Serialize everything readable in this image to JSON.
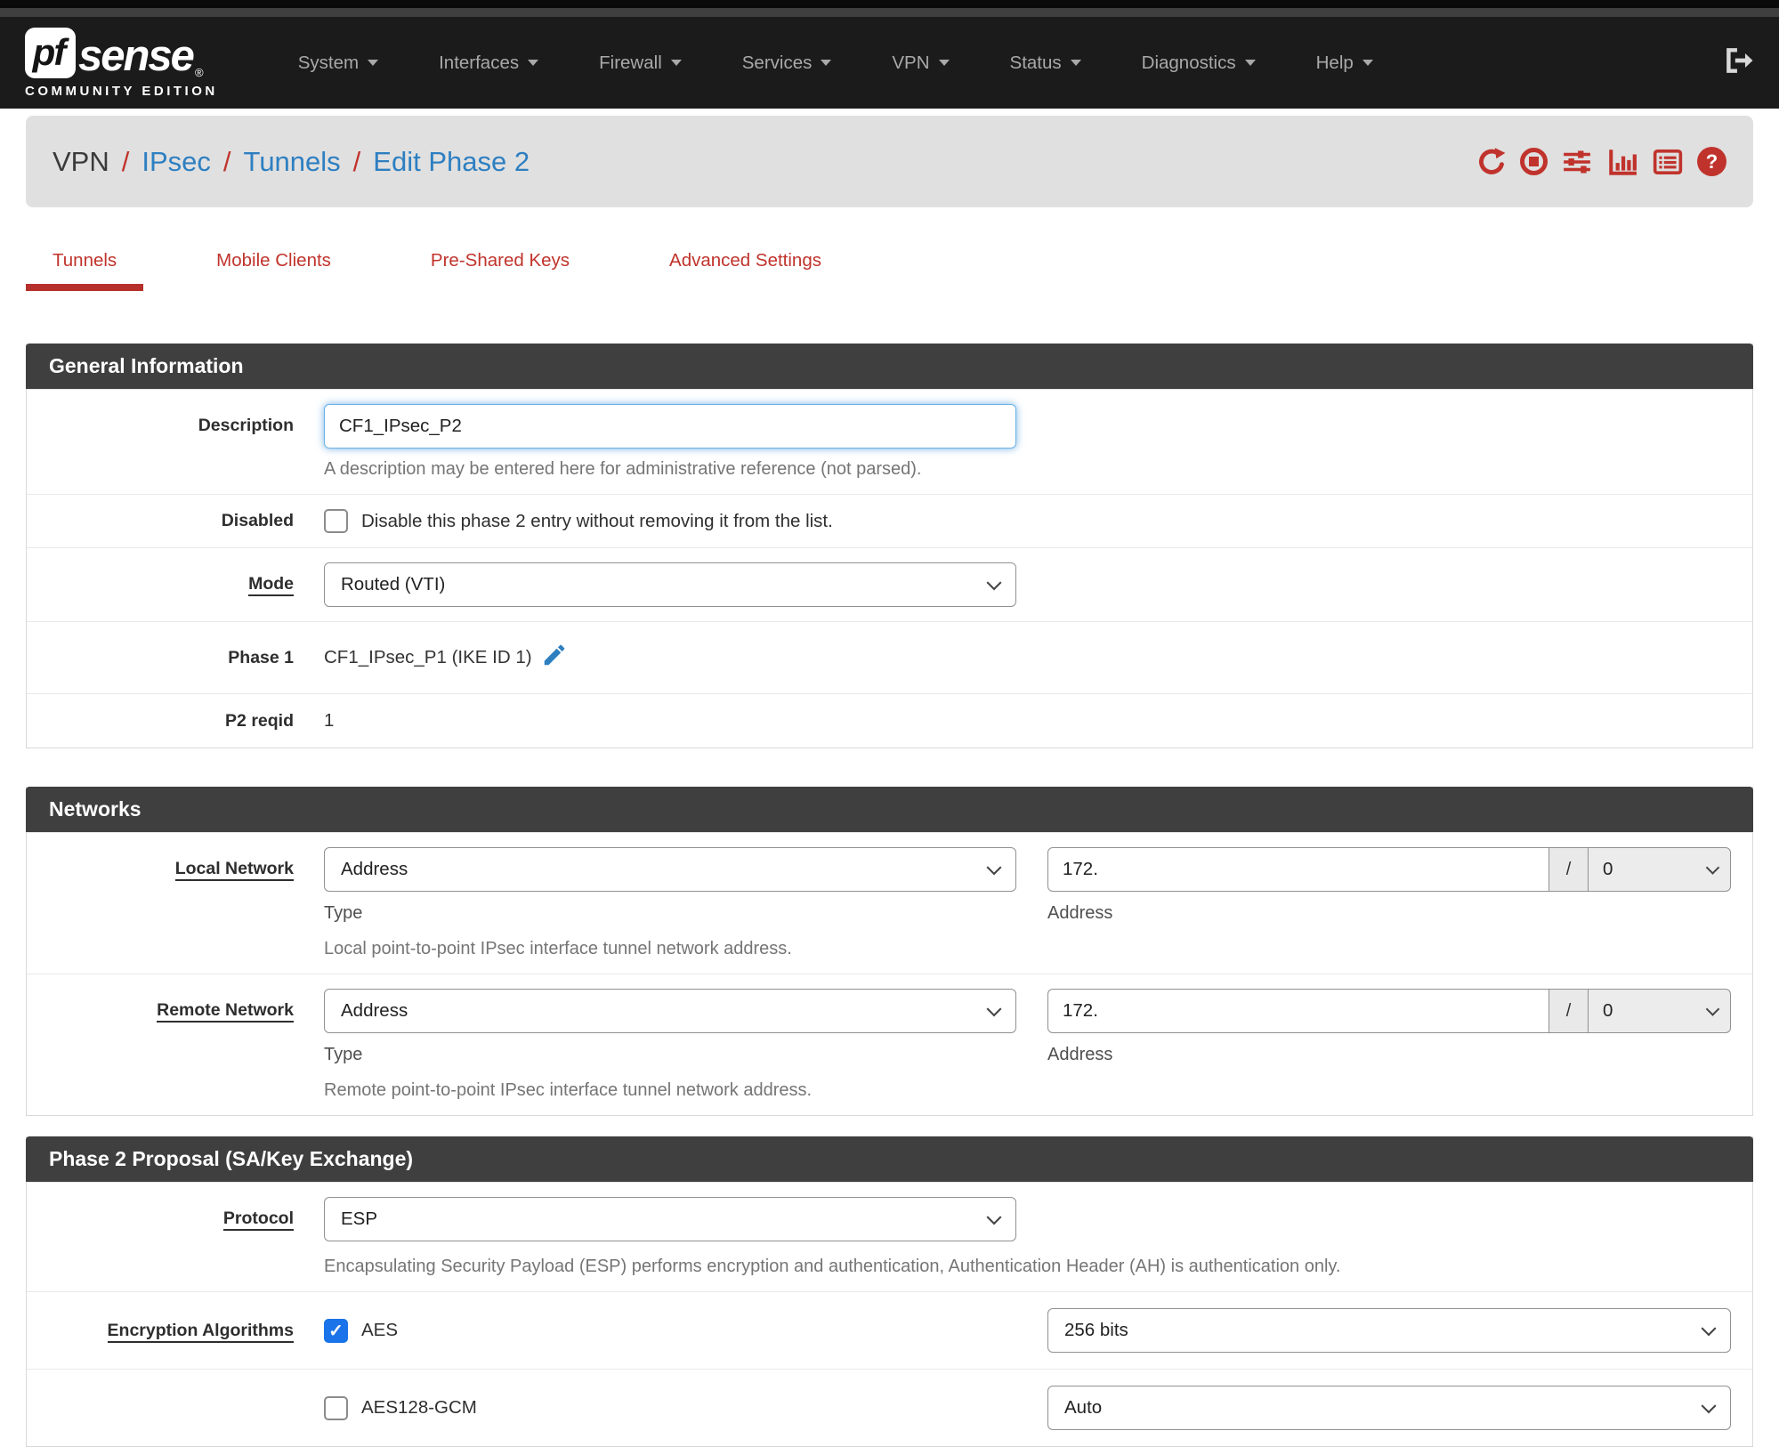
{
  "colors": {
    "accent_red": "#c0332c",
    "link_blue": "#2e7fc1",
    "navbar_bg": "#1b1b1b",
    "panel_heading_bg": "#3f3f3f",
    "breadcrumb_bg": "#e0e0e0",
    "checkbox_checked_blue": "#1a73e8",
    "pencil_blue": "#2e7fc0"
  },
  "navbar": {
    "logo": {
      "pf": "pf",
      "sense": "sense",
      "registered": "®",
      "subtitle": "COMMUNITY EDITION"
    },
    "items": [
      "System",
      "Interfaces",
      "Firewall",
      "Services",
      "VPN",
      "Status",
      "Diagnostics",
      "Help"
    ],
    "logout_icon": "sign-out-icon"
  },
  "breadcrumb": {
    "current": "VPN",
    "sep": "/",
    "links": [
      "IPsec",
      "Tunnels",
      "Edit Phase 2"
    ],
    "icons": [
      "refresh-icon",
      "stop-icon",
      "sliders-icon",
      "chart-bar-icon",
      "log-icon",
      "help-icon"
    ]
  },
  "tabs": {
    "items": [
      "Tunnels",
      "Mobile Clients",
      "Pre-Shared Keys",
      "Advanced Settings"
    ],
    "active": "Tunnels"
  },
  "general": {
    "title": "General Information",
    "description_label": "Description",
    "description_value": "CF1_IPsec_P2",
    "description_help": "A description may be entered here for administrative reference (not parsed).",
    "disabled_label": "Disabled",
    "disabled_text": "Disable this phase 2 entry without removing it from the list.",
    "disabled_checked": false,
    "mode_label": "Mode",
    "mode_value": "Routed (VTI)",
    "phase1_label": "Phase 1",
    "phase1_value": "CF1_IPsec_P1 (IKE ID 1)",
    "p2reqid_label": "P2 reqid",
    "p2reqid_value": "1"
  },
  "networks": {
    "title": "Networks",
    "separator": "/",
    "local": {
      "label": "Local Network",
      "type_value": "Address",
      "type_caption": "Type",
      "address_value": "172.",
      "address_caption": "Address",
      "prefix_value": "0",
      "help": "Local point-to-point IPsec interface tunnel network address."
    },
    "remote": {
      "label": "Remote Network",
      "type_value": "Address",
      "type_caption": "Type",
      "address_value": "172.",
      "address_caption": "Address",
      "prefix_value": "0",
      "help": "Remote point-to-point IPsec interface tunnel network address."
    }
  },
  "proposal": {
    "title": "Phase 2 Proposal (SA/Key Exchange)",
    "protocol_label": "Protocol",
    "protocol_value": "ESP",
    "protocol_help": "Encapsulating Security Payload (ESP) performs encryption and authentication, Authentication Header (AH) is authentication only.",
    "encryption_label": "Encryption Algorithms",
    "algorithms": [
      {
        "label": "AES",
        "checked": true,
        "key_length": "256 bits"
      },
      {
        "label": "AES128-GCM",
        "checked": false,
        "key_length": "Auto"
      }
    ]
  }
}
